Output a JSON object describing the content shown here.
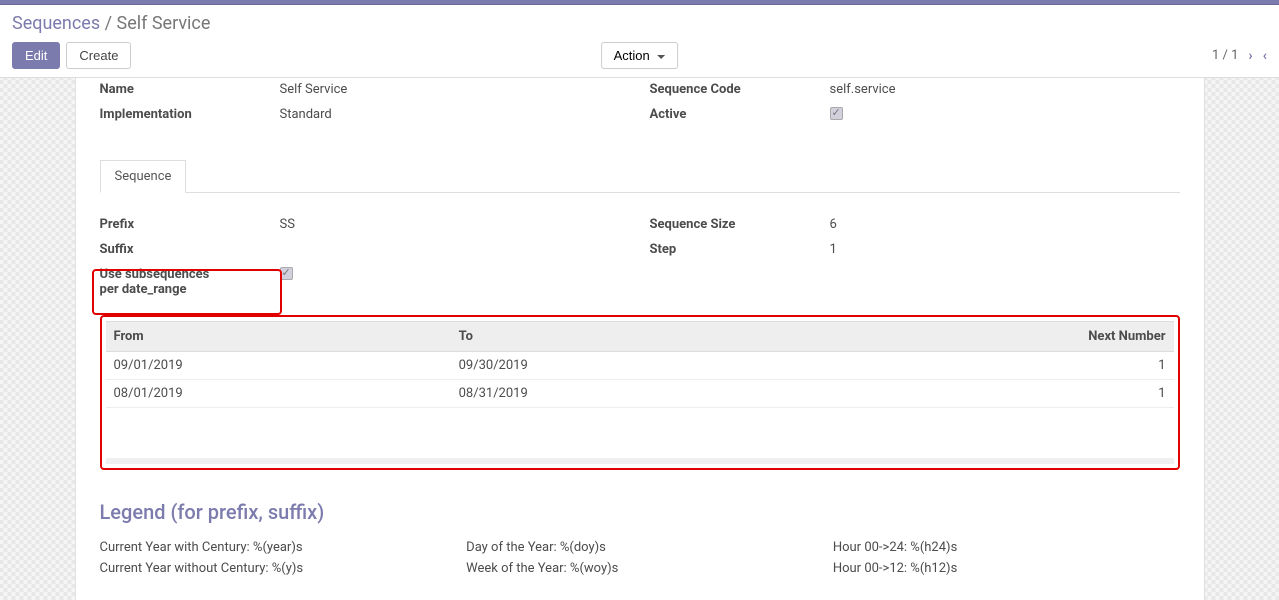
{
  "breadcrumb": {
    "parent": "Sequences",
    "sep": " / ",
    "current": "Self Service"
  },
  "buttons": {
    "edit": "Edit",
    "create": "Create",
    "action": "Action"
  },
  "pager": {
    "text": "1 / 1"
  },
  "form": {
    "name_label": "Name",
    "name_value": "Self Service",
    "impl_label": "Implementation",
    "impl_value": "Standard",
    "code_label": "Sequence Code",
    "code_value": "self.service",
    "active_label": "Active"
  },
  "tab": {
    "sequence": "Sequence"
  },
  "seq": {
    "prefix_label": "Prefix",
    "prefix_value": "SS",
    "suffix_label": "Suffix",
    "use_sub_label1": "Use subsequences",
    "use_sub_label2": "per date_range",
    "size_label": "Sequence Size",
    "size_value": "6",
    "step_label": "Step",
    "step_value": "1"
  },
  "table": {
    "headers": {
      "from": "From",
      "to": "To",
      "next": "Next Number"
    },
    "rows": [
      {
        "from": "09/01/2019",
        "to": "09/30/2019",
        "next": "1"
      },
      {
        "from": "08/01/2019",
        "to": "08/31/2019",
        "next": "1"
      }
    ]
  },
  "legend": {
    "title": "Legend (for prefix, suffix)",
    "col1": {
      "a": "Current Year with Century: %(year)s",
      "b": "Current Year without Century: %(y)s"
    },
    "col2": {
      "a": "Day of the Year: %(doy)s",
      "b": "Week of the Year: %(woy)s"
    },
    "col3": {
      "a": "Hour 00->24: %(h24)s",
      "b": "Hour 00->12: %(h12)s"
    }
  }
}
